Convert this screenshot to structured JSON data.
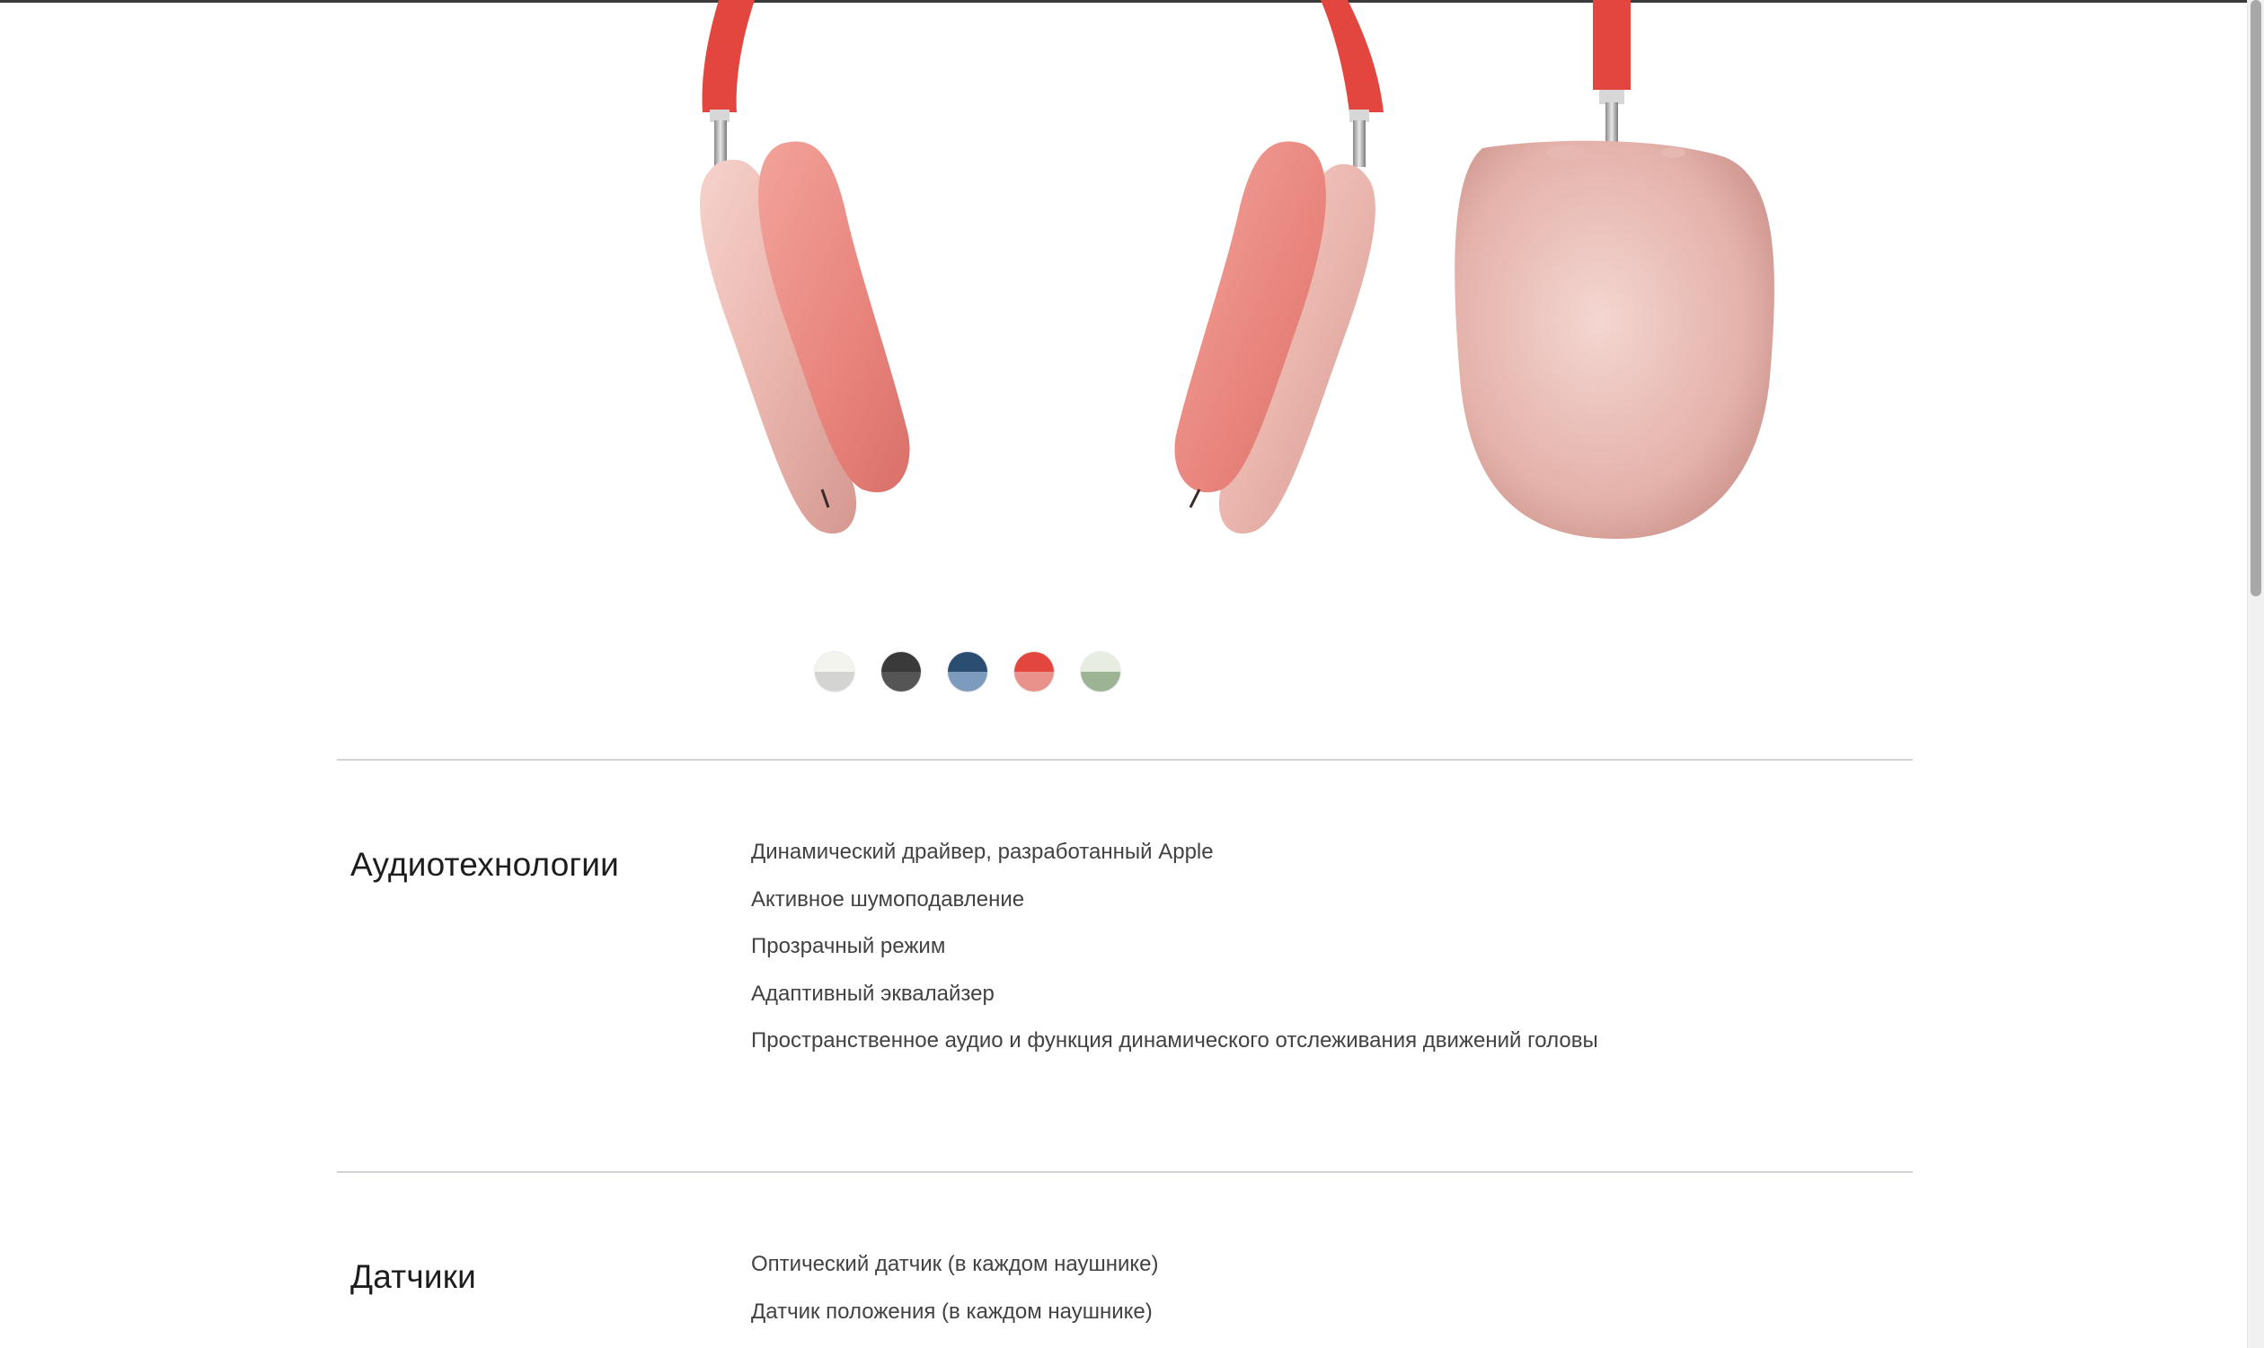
{
  "product": {
    "image_alt": "AirPods Max",
    "colors": [
      {
        "name": "silver",
        "top": "#f4f4ef",
        "bottom": "#d4d4d2"
      },
      {
        "name": "space-gray",
        "top": "#3a3a3a",
        "bottom": "#555555"
      },
      {
        "name": "sky-blue",
        "top": "#2c4d72",
        "bottom": "#7d9bbd"
      },
      {
        "name": "pink-red",
        "top": "#e2463e",
        "bottom": "#e9928c"
      },
      {
        "name": "green",
        "top": "#e8ede2",
        "bottom": "#9db494"
      }
    ]
  },
  "specs": [
    {
      "title": "Аудиотехнологии",
      "items": [
        "Динамический драйвер, разработанный Apple",
        "Активное шумоподавление",
        "Прозрачный режим",
        "Адаптивный эквалайзер",
        "Пространственное аудио и функция динамического отслеживания движений головы"
      ]
    },
    {
      "title": "Датчики",
      "items": [
        "Оптический датчик (в каждом наушнике)",
        "Датчик положения (в каждом наушнике)"
      ]
    }
  ]
}
